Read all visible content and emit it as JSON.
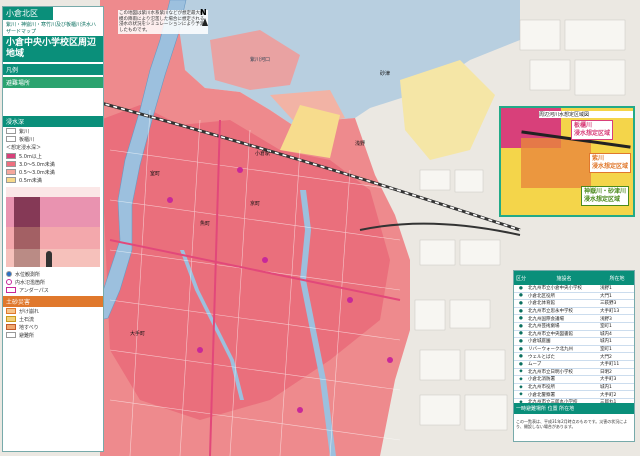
{
  "legend": {
    "ward": "小倉北区",
    "subtitle": "紫川・神嶽川・寒竹川及び板櫃川洪水ハザードマップ",
    "title": "小倉中央小学校区周辺地域",
    "section_hanrei": "凡例",
    "section_shelter": "避難場所",
    "section_flood": "浸水深",
    "section_landslide": "土砂災害",
    "flood_header": "＜想定浸水深＞",
    "flood_levels": [
      "5.0m以上",
      "3.0～5.0m未満",
      "0.5～3.0m未満",
      "0.5m未満"
    ],
    "flood_colors": [
      "#d8407a",
      "#ee6f7f",
      "#f5a79c",
      "#f7d98a"
    ],
    "rivers": [
      "紫川",
      "板櫃川"
    ],
    "items": [
      "水位観測所",
      "内水氾濫箇所",
      "アンダーパス",
      "がけ崩れ",
      "土石流",
      "地すべり",
      "避難所"
    ],
    "compass": "N"
  },
  "top_note": "この地図は紫川水系紫川などが想定最大規模の降雨により氾濫した場合に想定される浸水の状況をシミュレーションにより予測したものです。",
  "map_labels": {
    "sea": "紫川河口",
    "area1": "砂津",
    "area2": "浅野",
    "area3": "小倉駅",
    "area4": "魚町",
    "area5": "京町",
    "area6": "室町",
    "area7": "大手町"
  },
  "inset": {
    "title": "周辺河川水想定区域図",
    "box1": "板櫃川\n浸水想定区域",
    "box2": "紫川\n浸水想定区域",
    "box3": "神嶽川・砂津川\n浸水想定区域"
  },
  "shelter_table": {
    "headers": [
      "区分",
      "施設名",
      "所在地"
    ],
    "categories": [
      "避難所",
      "指定緊急避難場所"
    ],
    "rows": [
      {
        "n": "北九州市立小倉中央小学校",
        "a": "浅野1"
      },
      {
        "n": "小倉北区役所",
        "a": "大門1"
      },
      {
        "n": "小倉北体育館",
        "a": "三萩野3"
      },
      {
        "n": "北九州市立思永中学校",
        "a": "大手町13"
      },
      {
        "n": "北九州国際会議場",
        "a": "浅野3"
      },
      {
        "n": "北九州芸術劇場",
        "a": "室町1"
      },
      {
        "n": "北九州市立中央図書館",
        "a": "城内4"
      },
      {
        "n": "小倉城庭園",
        "a": "城内1"
      },
      {
        "n": "リバーウォーク北九州",
        "a": "室町1"
      },
      {
        "n": "ウェルとばた",
        "a": "大門2"
      },
      {
        "n": "ムーブ",
        "a": "大手町11"
      },
      {
        "n": "北九州市立日明小学校",
        "a": "日明2"
      },
      {
        "n": "小倉北消防署",
        "a": "大手町3"
      },
      {
        "n": "北九州市役所",
        "a": "城内1"
      },
      {
        "n": "小倉北警察署",
        "a": "大手町2"
      },
      {
        "n": "北九州市立三郎丸小学校",
        "a": "三郎丸1"
      }
    ],
    "footer": "一時避難場所  位置  所在地",
    "note": "この一覧表は、平成31年2月時点のものです。災害の状況により、開設しない場合があります。"
  }
}
